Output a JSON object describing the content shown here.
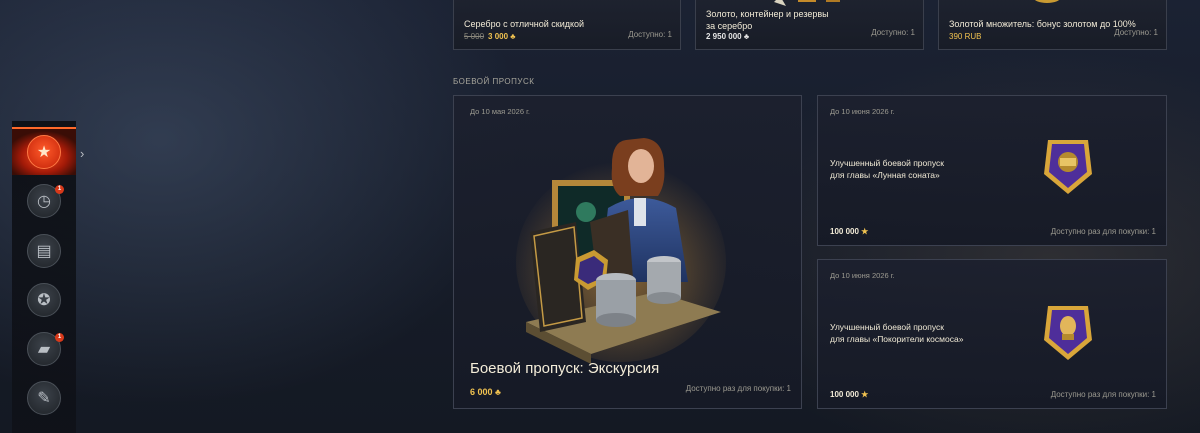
{
  "sidebar": {
    "items": [
      {
        "icon": "star-icon",
        "glyph": "★",
        "active": true
      },
      {
        "icon": "clock-icon",
        "glyph": "◷",
        "badge": "1"
      },
      {
        "icon": "money-stack-icon",
        "glyph": "▤"
      },
      {
        "icon": "wreath-star-icon",
        "glyph": "✪"
      },
      {
        "icon": "tank-icon",
        "glyph": "▰",
        "badge": "1"
      },
      {
        "icon": "brush-icon",
        "glyph": "✎"
      }
    ],
    "expand_glyph": "›"
  },
  "top_cards": [
    {
      "title": "Серебро с отличной скидкой",
      "old_price": "5 000",
      "price": "3 000",
      "currency": "♣",
      "availability": "Доступно: 1"
    },
    {
      "title_line1": "Золото, контейнер и резервы",
      "title_line2": "за серебро",
      "price": "2 950 000",
      "currency": "♣",
      "availability": "Доступно: 1"
    },
    {
      "title": "Золотой множитель: бонус золотом до 100%",
      "price": "390 RUB",
      "availability": "Доступно: 1"
    }
  ],
  "section": {
    "title": "БОЕВОЙ ПРОПУСК"
  },
  "battle_pass_main": {
    "date": "До 10 мая 2026 г.",
    "title": "Боевой пропуск: Экскурсия",
    "price": "6 000",
    "currency": "♣",
    "availability": "Доступно раз для покупки: 1"
  },
  "battle_pass_offers": [
    {
      "date": "До 10 июня 2026 г.",
      "title_line1": "Улучшенный боевой пропуск",
      "title_line2": "для главы «Лунная соната»",
      "price": "100 000",
      "currency": "★",
      "availability": "Доступно раз для покупки: 1"
    },
    {
      "date": "До 10 июня 2026 г.",
      "title_line1": "Улучшенный боевой пропуск",
      "title_line2": "для главы «Покорители космоса»",
      "price": "100 000",
      "currency": "★",
      "availability": "Доступно раз для покупки: 1"
    }
  ],
  "colors": {
    "accent_gold": "#f0c250",
    "active_red": "#e0321a",
    "badge_purple": "#5a2fb0"
  }
}
